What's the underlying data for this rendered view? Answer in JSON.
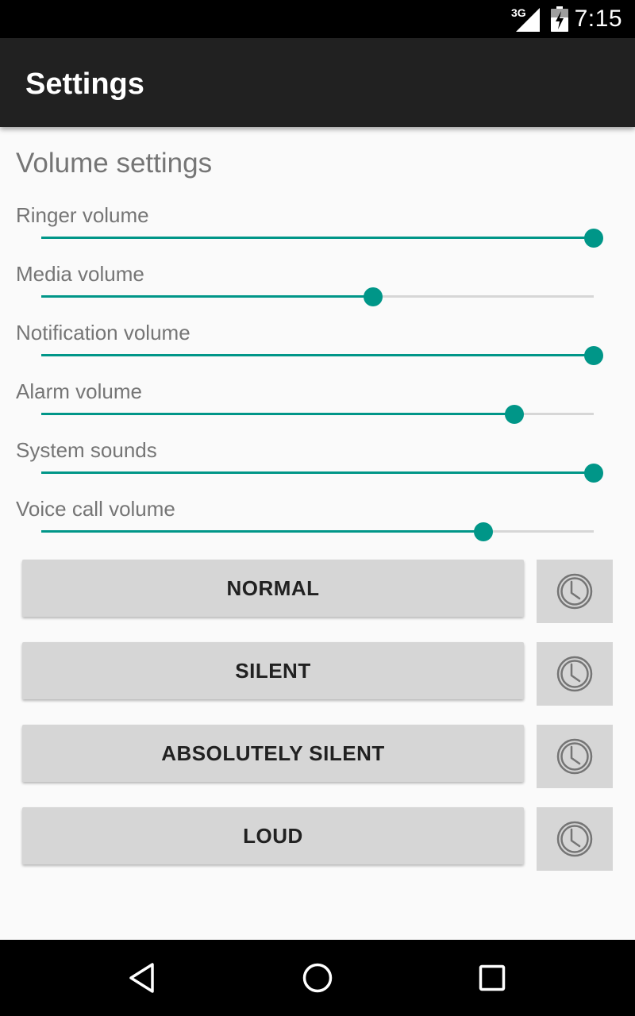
{
  "status_bar": {
    "time": "7:15",
    "network": "3G",
    "signal_icon": "cellular-signal-icon",
    "battery_icon": "battery-charging-icon"
  },
  "app_bar": {
    "title": "Settings"
  },
  "content": {
    "section_title": "Volume settings",
    "volumes": [
      {
        "label": "Ringer volume",
        "level": 1.0
      },
      {
        "label": "Media volume",
        "level": 0.6
      },
      {
        "label": "Notification volume",
        "level": 1.0
      },
      {
        "label": "Alarm volume",
        "level": 0.857
      },
      {
        "label": "System sounds",
        "level": 1.0
      },
      {
        "label": "Voice call volume",
        "level": 0.8
      }
    ],
    "modes": [
      {
        "label": "NORMAL",
        "timer_icon": "clock-icon"
      },
      {
        "label": "SILENT",
        "timer_icon": "clock-icon"
      },
      {
        "label": "ABSOLUTELY SILENT",
        "timer_icon": "clock-icon"
      },
      {
        "label": "LOUD",
        "timer_icon": "clock-icon"
      }
    ]
  },
  "nav_bar": {
    "icons": [
      "back-icon",
      "home-icon",
      "recents-icon"
    ]
  },
  "colors": {
    "accent": "#009688",
    "app_bar": "#212121",
    "button": "#d6d6d6",
    "background": "#fafafa"
  }
}
